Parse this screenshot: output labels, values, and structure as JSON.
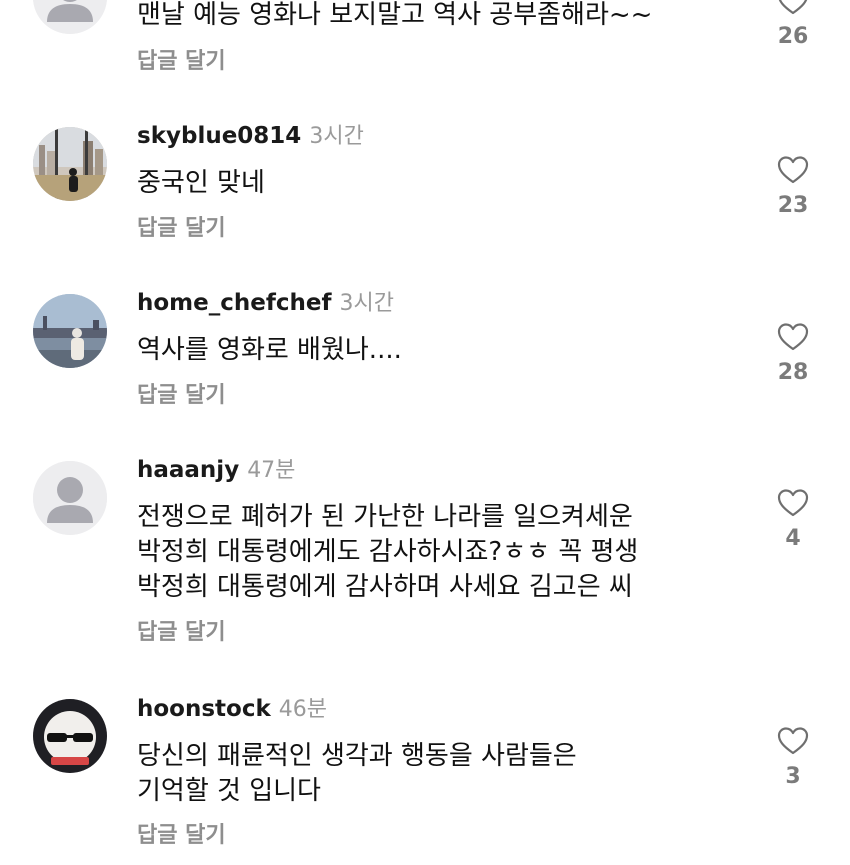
{
  "comments": [
    {
      "username": "",
      "time": "",
      "lines": [
        "맨날 예능 영화나 보지말고 역사 공부좀해라~~"
      ],
      "reply_label": "답글 달기",
      "likes": "26"
    },
    {
      "username": "skyblue0814",
      "time": "3시간",
      "lines": [
        "중국인 맞네"
      ],
      "reply_label": "답글 달기",
      "likes": "23"
    },
    {
      "username": "home_chefchef",
      "time": "3시간",
      "lines": [
        "역사를 영화로 배웠나...."
      ],
      "reply_label": "답글 달기",
      "likes": "28"
    },
    {
      "username": "haaanjy",
      "time": "47분",
      "lines": [
        "전쟁으로 폐허가 된 가난한 나라를  일으켜세운",
        "박정희 대통령에게도 감사하시죠?ㅎㅎ 꼭 평생",
        "박정희 대통령에게 감사하며 사세요 김고은 씨"
      ],
      "reply_label": "답글 달기",
      "likes": "4"
    },
    {
      "username": "hoonstock",
      "time": "46분",
      "lines": [
        "당신의 패륜적인 생각과 행동을 사람들은",
        "기억할 것 입니다"
      ],
      "reply_label": "답글 달기",
      "likes": "3"
    }
  ],
  "colors": {
    "username": "#1a1a1a",
    "timestamp": "#9a9a9a",
    "reply": "#8e8e8e",
    "like_count": "#7b7b7b"
  },
  "icons": {
    "like": "heart-outline-icon",
    "avatar_default": "default-user-icon"
  }
}
